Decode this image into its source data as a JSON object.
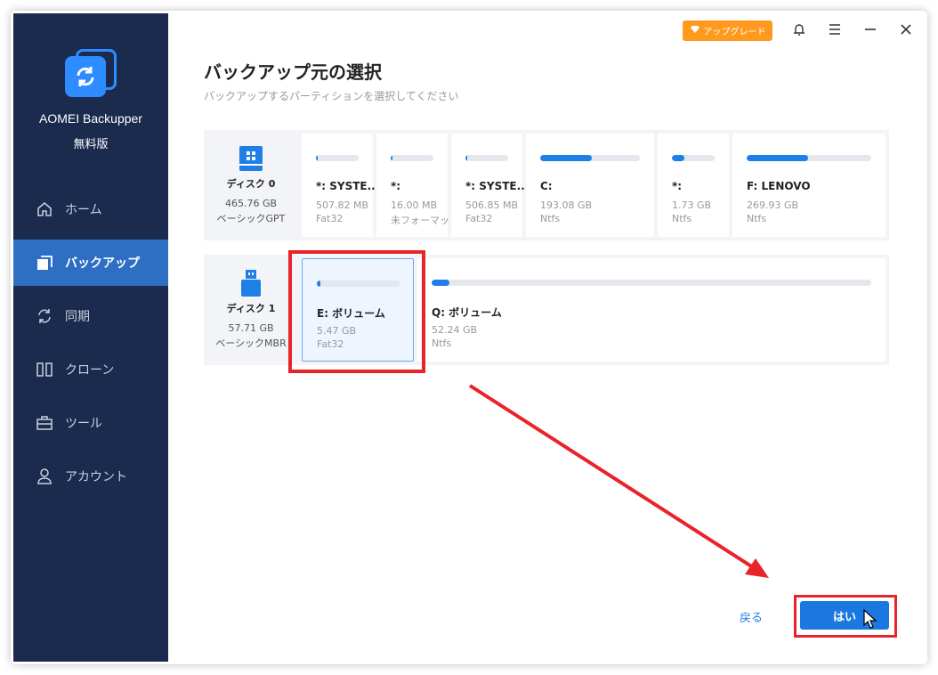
{
  "app": {
    "name": "AOMEI Backupper",
    "edition": "無料版"
  },
  "titlebar": {
    "upgrade_label": "アップグレード",
    "upgrade_icon": "diamond-icon",
    "bell_icon": "bell-icon",
    "menu_icon": "hamburger-menu-icon",
    "minimize_icon": "minimize-icon",
    "close_icon": "close-icon"
  },
  "sidebar": {
    "items": [
      {
        "label": "ホーム",
        "icon": "home-icon",
        "active": false
      },
      {
        "label": "バックアップ",
        "icon": "backup-icon",
        "active": true
      },
      {
        "label": "同期",
        "icon": "sync-icon",
        "active": false
      },
      {
        "label": "クローン",
        "icon": "clone-icon",
        "active": false
      },
      {
        "label": "ツール",
        "icon": "toolbox-icon",
        "active": false
      },
      {
        "label": "アカウント",
        "icon": "user-icon",
        "active": false
      }
    ]
  },
  "main": {
    "title": "バックアップ元の選択",
    "subtitle": "バックアップするパーティションを選択してください"
  },
  "disks": [
    {
      "name": "ディスク 0",
      "size": "465.76 GB",
      "type": "ベーシックGPT",
      "icon": "hard-disk-icon",
      "partitions": [
        {
          "name": "*: SYSTE...",
          "size": "507.82 MB",
          "fs": "Fat32",
          "used_fraction": 0.04
        },
        {
          "name": "*:",
          "size": "16.00 MB",
          "fs": "未フォーマット",
          "used_fraction": 0.04
        },
        {
          "name": "*: SYSTE...",
          "size": "506.85 MB",
          "fs": "Fat32",
          "used_fraction": 0.04
        },
        {
          "name": "C:",
          "size": "193.08 GB",
          "fs": "Ntfs",
          "used_fraction": 0.52
        },
        {
          "name": "*:",
          "size": "1.73 GB",
          "fs": "Ntfs",
          "used_fraction": 0.3
        },
        {
          "name": "F: LENOVO",
          "size": "269.93 GB",
          "fs": "Ntfs",
          "used_fraction": 0.49
        }
      ]
    },
    {
      "name": "ディスク 1",
      "size": "57.71 GB",
      "type": "ベーシックMBR",
      "icon": "usb-drive-icon",
      "partitions": [
        {
          "name": "E: ボリューム",
          "size": "5.47 GB",
          "fs": "Fat32",
          "used_fraction": 0.03,
          "selected": true
        },
        {
          "name": "Q: ボリューム",
          "size": "52.24 GB",
          "fs": "Ntfs",
          "used_fraction": 0.01
        }
      ]
    }
  ],
  "footer": {
    "back_label": "戻る",
    "confirm_label": "はい"
  },
  "colors": {
    "sidebar_bg": "#1a2b4d",
    "active_nav": "#2e6fc4",
    "accent": "#1a78e0",
    "annotation_red": "#e8232a",
    "upgrade": "#ff9a1f"
  }
}
